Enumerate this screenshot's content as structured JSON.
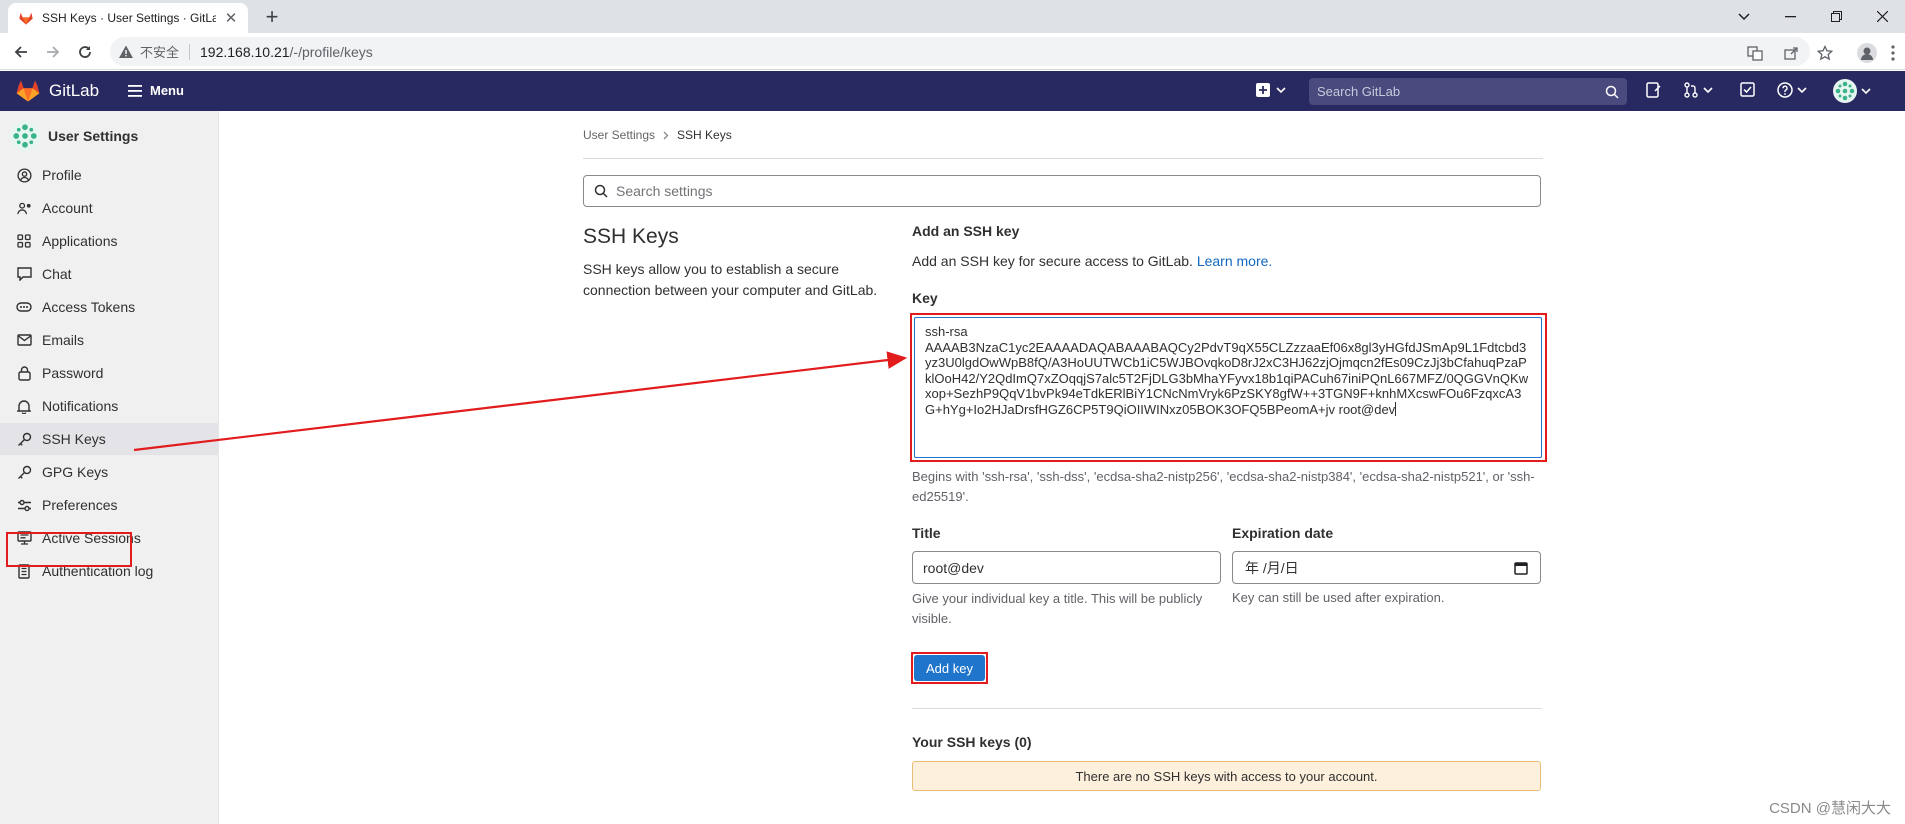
{
  "browser": {
    "tab_title": "SSH Keys · User Settings · GitLab",
    "url_security": "不安全",
    "url_host": "192.168.10.21",
    "url_path": "/-/profile/keys"
  },
  "header": {
    "brand": "GitLab",
    "menu_label": "Menu",
    "search_placeholder": "Search GitLab"
  },
  "sidebar": {
    "title": "User Settings",
    "items": [
      {
        "label": "Profile",
        "icon": "profile-icon"
      },
      {
        "label": "Account",
        "icon": "account-icon"
      },
      {
        "label": "Applications",
        "icon": "applications-icon"
      },
      {
        "label": "Chat",
        "icon": "chat-icon"
      },
      {
        "label": "Access Tokens",
        "icon": "token-icon"
      },
      {
        "label": "Emails",
        "icon": "mail-icon"
      },
      {
        "label": "Password",
        "icon": "lock-icon"
      },
      {
        "label": "Notifications",
        "icon": "bell-icon"
      },
      {
        "label": "SSH Keys",
        "icon": "key-icon",
        "active": true
      },
      {
        "label": "GPG Keys",
        "icon": "key-icon"
      },
      {
        "label": "Preferences",
        "icon": "preferences-icon"
      },
      {
        "label": "Active Sessions",
        "icon": "monitor-icon"
      },
      {
        "label": "Authentication log",
        "icon": "log-icon"
      }
    ]
  },
  "breadcrumb": {
    "parent": "User Settings",
    "current": "SSH Keys"
  },
  "settings_search_placeholder": "Search settings",
  "section": {
    "title": "SSH Keys",
    "description": "SSH keys allow you to establish a secure connection between your computer and GitLab."
  },
  "form": {
    "heading": "Add an SSH key",
    "intro": "Add an SSH key for secure access to GitLab.",
    "learn_more": "Learn more.",
    "key_label": "Key",
    "key_value": "ssh-rsa\nAAAAB3NzaC1yc2EAAAADAQABAAABAQCy2PdvT9qX55CLZzzaaEf06x8gl3yHGfdJSmAp9L1Fdtcbd3yz3U0lgdOwWpB8fQ/A3HoUUTWCb1iC5WJBOvqkoD8rJ2xC3HJ62zjOjmqcn2fEs09CzJj3bCfahuqPzaPklOoH42/Y2QdImQ7xZOqqjS7alc5T2FjDLG3bMhaYFyvx18b1qiPACuh67iniPQnL667MFZ/0QGGVnQKwxop+SezhP9QqV1bvPk94eTdkERlBiY1CNcNmVryk6PzSKY8gfW++3TGN9F+knhMXcswFOu6FzqxcA3G+hYg+Io2HJaDrsfHGZ6CP5T9QiOIIWINxz05BOK3OFQ5BPeomA+jv root@dev",
    "key_help": "Begins with 'ssh-rsa', 'ssh-dss', 'ecdsa-sha2-nistp256', 'ecdsa-sha2-nistp384', 'ecdsa-sha2-nistp521', or 'ssh-ed25519'.",
    "title_label": "Title",
    "title_value": "root@dev",
    "title_help": "Give your individual key a title. This will be publicly visible.",
    "expiration_label": "Expiration date",
    "expiration_value": "年 /月/日",
    "expiration_help": "Key can still be used after expiration.",
    "submit_label": "Add key"
  },
  "keys_list": {
    "heading": "Your SSH keys (0)",
    "empty_message": "There are no SSH keys with access to your account."
  },
  "watermark": "CSDN @慧闲大大",
  "colors": {
    "header_bg": "#292961",
    "accent": "#1f75cb",
    "annotation": "#e21c1c"
  }
}
